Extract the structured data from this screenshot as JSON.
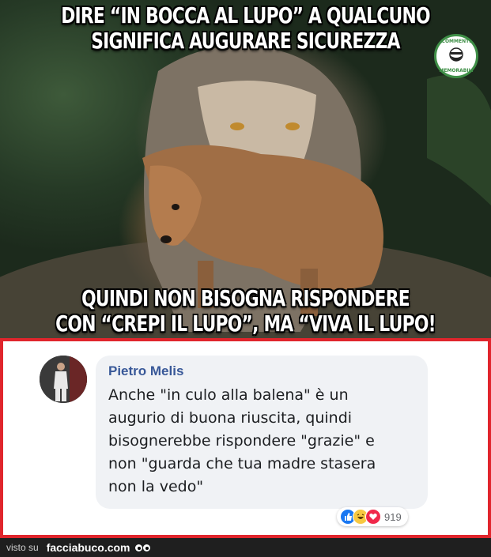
{
  "meme": {
    "top_caption": "DIRE “IN BOCCA AL LUPO” A QUALCUNO\nSIGNIFICA AUGURARE SICUREZZA",
    "bottom_caption": "QUINDI NON BISOGNA RISPONDERE\nCON “CREPI IL LUPO”, MA “VIVA IL LUPO! ”",
    "logo_top_text": "COMMENTI",
    "logo_bottom_text": "MEMORABILI"
  },
  "comment": {
    "author": "Pietro Melis",
    "text": "Anche \"in culo alla balena\" è un\naugurio di buona riuscita, quindi\nbisognerebbe rispondere \"grazie\" e\nnon \"guarda che tua madre stasera\nnon la vedo\"",
    "reaction_count": "919",
    "reactions": [
      "like-icon",
      "haha-icon",
      "love-icon"
    ]
  },
  "footer": {
    "visto_label": "visto su",
    "site": "facciabuco.com"
  },
  "colors": {
    "border_red": "#e0252c",
    "author_blue": "#385898",
    "bubble_bg": "#f0f2f5",
    "footer_bg": "#1f1f1f"
  }
}
